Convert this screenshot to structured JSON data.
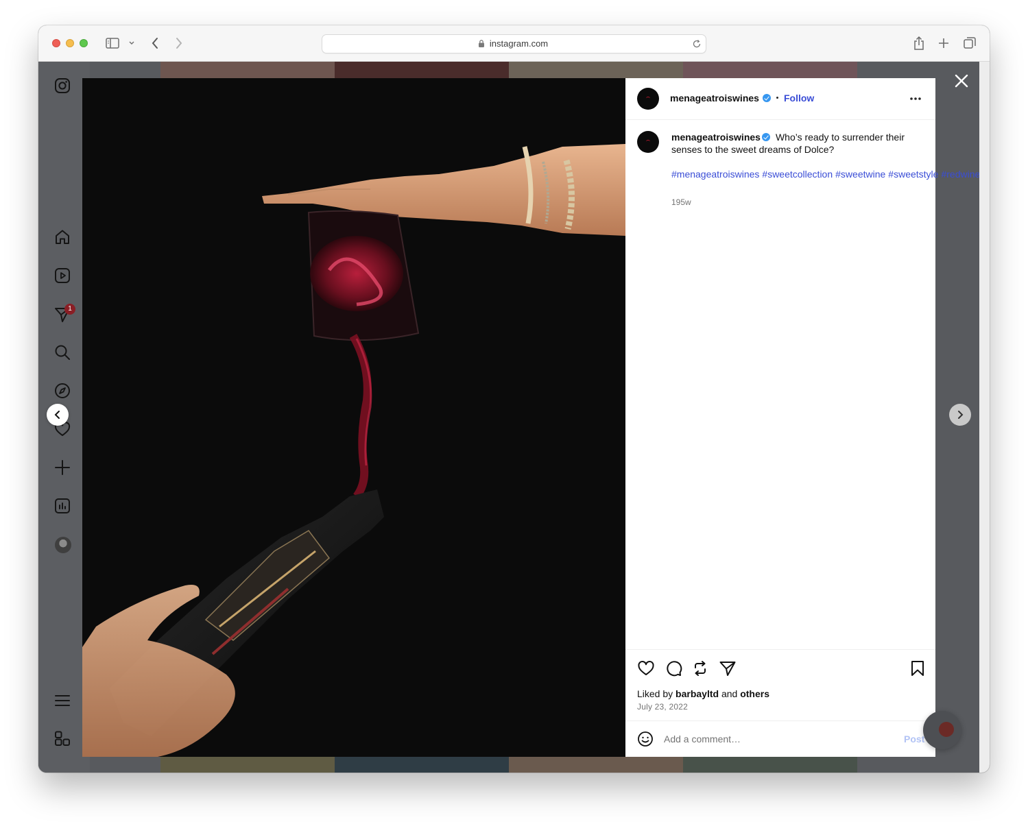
{
  "browser": {
    "url": "instagram.com"
  },
  "sidebar": {
    "notifications_count": "1",
    "icons": [
      "instagram-logo-icon",
      "home-icon",
      "reels-icon",
      "messages-icon",
      "search-icon",
      "explore-icon",
      "heart-icon",
      "create-icon",
      "dashboard-icon",
      "profile-avatar",
      "menu-icon",
      "apps-icon"
    ]
  },
  "post": {
    "username": "menageatroiswines",
    "follow_label": "Follow",
    "caption": "Who’s ready to surrender their senses to the sweet dreams of Dolce?",
    "hashtags": [
      "#menageatroiswines",
      "#sweetcollection",
      "#sweetwine",
      "#sweetstyle",
      "#redwine"
    ],
    "time_ago": "195w",
    "liked_prefix": "Liked by",
    "liked_user": "barbayltd",
    "liked_and": "and",
    "liked_others": "others",
    "date": "July 23, 2022",
    "comment_placeholder": "Add a comment…",
    "post_label": "Post"
  },
  "colors": {
    "link": "#3a4dd6",
    "verified": "#3797f0",
    "badge": "#8a1e25"
  }
}
